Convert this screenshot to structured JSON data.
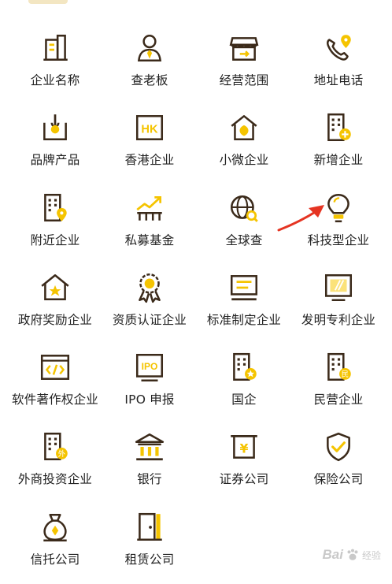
{
  "colors": {
    "accent": "#f5c400",
    "stroke": "#3b2a1a",
    "text": "#222222",
    "arrow": "#e53422"
  },
  "grid": [
    {
      "name": "enterprise-name",
      "icon": "building-icon",
      "label": "企业名称"
    },
    {
      "name": "check-boss",
      "icon": "person-icon",
      "label": "查老板"
    },
    {
      "name": "business-scope",
      "icon": "storefront-icon",
      "label": "经营范围"
    },
    {
      "name": "address-phone",
      "icon": "phone-location-icon",
      "label": "地址电话"
    },
    {
      "name": "brand-products",
      "icon": "brand-stamp-icon",
      "label": "品牌产品"
    },
    {
      "name": "hk-enterprise",
      "icon": "hk-icon",
      "label": "香港企业"
    },
    {
      "name": "small-micro",
      "icon": "leaf-house-icon",
      "label": "小微企业"
    },
    {
      "name": "new-enterprise",
      "icon": "building-plus-icon",
      "label": "新增企业"
    },
    {
      "name": "nearby-enterprise",
      "icon": "building-pin-icon",
      "label": "附近企业"
    },
    {
      "name": "private-fund",
      "icon": "growth-chart-icon",
      "label": "私募基金"
    },
    {
      "name": "global-search",
      "icon": "globe-search-icon",
      "label": "全球查"
    },
    {
      "name": "tech-enterprise",
      "icon": "lightbulb-icon",
      "label": "科技型企业"
    },
    {
      "name": "gov-award",
      "icon": "star-house-icon",
      "label": "政府奖励企业"
    },
    {
      "name": "qualification",
      "icon": "rosette-icon",
      "label": "资质认证企业"
    },
    {
      "name": "standard-setting",
      "icon": "monitor-icon",
      "label": "标准制定企业"
    },
    {
      "name": "invention-patent",
      "icon": "patent-icon",
      "label": "发明专利企业"
    },
    {
      "name": "software-copyright",
      "icon": "code-window-icon",
      "label": "软件著作权企业"
    },
    {
      "name": "ipo-filing",
      "icon": "ipo-icon",
      "label": "IPO 申报"
    },
    {
      "name": "state-owned",
      "icon": "building-star-icon",
      "label": "国企"
    },
    {
      "name": "private-enterprise",
      "icon": "building-min-icon",
      "label": "民营企业"
    },
    {
      "name": "foreign-investment",
      "icon": "building-wai-icon",
      "label": "外商投资企业"
    },
    {
      "name": "bank",
      "icon": "bank-icon",
      "label": "银行"
    },
    {
      "name": "securities",
      "icon": "securities-icon",
      "label": "证券公司"
    },
    {
      "name": "insurance",
      "icon": "shield-check-icon",
      "label": "保险公司"
    },
    {
      "name": "trust",
      "icon": "money-bag-icon",
      "label": "信托公司"
    },
    {
      "name": "leasing",
      "icon": "door-icon",
      "label": "租赁公司"
    }
  ],
  "glyphs": {
    "hk": "HK",
    "ipo": "IPO",
    "yen": "¥",
    "min": "民",
    "wai": "外"
  },
  "watermark": {
    "text": "Bai",
    "sub": "经验"
  }
}
